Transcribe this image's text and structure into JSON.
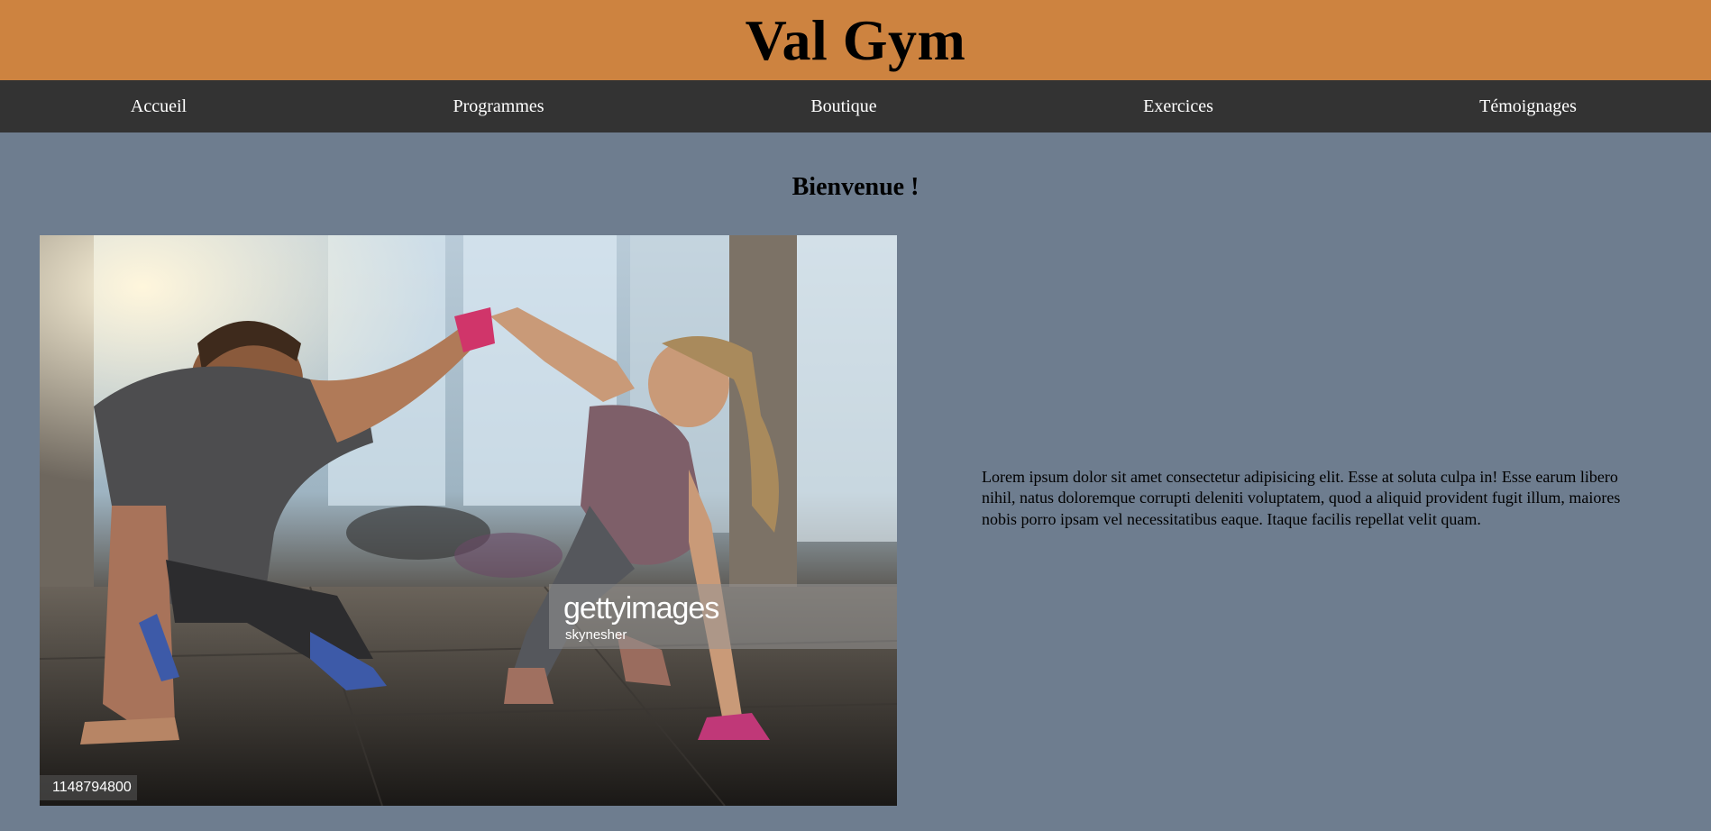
{
  "header": {
    "title": "Val Gym",
    "background": "#cd8340"
  },
  "nav": {
    "background": "#333333",
    "items": [
      {
        "label": "Accueil"
      },
      {
        "label": "Programmes"
      },
      {
        "label": "Boutique"
      },
      {
        "label": "Exercices"
      },
      {
        "label": "Témoignages"
      }
    ]
  },
  "main": {
    "heading": "Bienvenue !",
    "photo": {
      "watermark_brand": "gettyimages",
      "watermark_credit": "skynesher",
      "image_id": "1148794800"
    },
    "paragraph": "Lorem ipsum dolor sit amet consectetur adipisicing elit. Esse at soluta culpa in! Esse earum libero nihil, natus doloremque corrupti deleniti voluptatem, quod a aliquid provident fugit illum, maiores nobis porro ipsam vel necessitatibus eaque. Itaque facilis repellat velit quam."
  },
  "colors": {
    "page_background": "#6e7d8f"
  }
}
